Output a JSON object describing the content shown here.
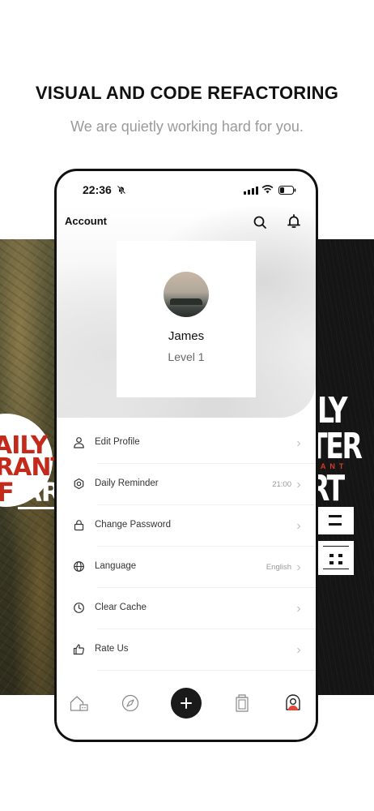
{
  "promo": {
    "headline": "VISUAL AND CODE REFACTORING",
    "subline": "We are quietly working hard for you."
  },
  "posters": {
    "left": {
      "line1": "AILY",
      "line2": "RANT",
      "line3_red": "F ",
      "line3_white": "AR"
    },
    "right": {
      "line1": "ILY",
      "line2": "TER",
      "accent": "TANT",
      "line3": "RT"
    }
  },
  "status_bar": {
    "time": "22:36"
  },
  "header": {
    "title": "Account"
  },
  "profile": {
    "name": "James",
    "level": "Level 1"
  },
  "menu": {
    "items": [
      {
        "label": "Edit Profile",
        "value": "",
        "icon": "user-icon"
      },
      {
        "label": "Daily Reminder",
        "value": "21:00",
        "icon": "reminder-icon"
      },
      {
        "label": "Change Password",
        "value": "",
        "icon": "lock-icon"
      },
      {
        "label": "Language",
        "value": "English",
        "icon": "globe-icon"
      },
      {
        "label": "Clear Cache",
        "value": "",
        "icon": "clock-icon"
      },
      {
        "label": "Rate Us",
        "value": "",
        "icon": "thumbs-up-icon"
      }
    ]
  },
  "tabbar": {
    "tabs": [
      "home-icon",
      "compass-icon",
      "plus-icon",
      "bag-icon",
      "profile-icon"
    ],
    "active": "profile-icon"
  },
  "colors": {
    "accent_red": "#c42a1c",
    "text_primary": "#111111",
    "text_secondary": "#999999",
    "add_button": "#1a1a1a"
  }
}
